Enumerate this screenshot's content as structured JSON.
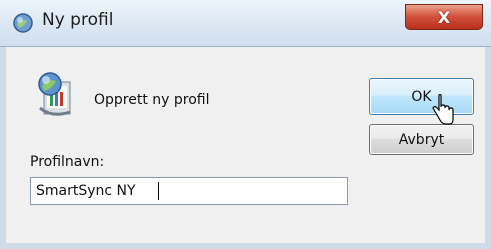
{
  "window": {
    "title": "Ny profil",
    "title_icon": "mail-profile-icon",
    "close_glyph": "X"
  },
  "dialog": {
    "create_label": "Opprett ny profil",
    "field_label": "Profilnavn:",
    "name_value": "SmartSync NY",
    "ok_label": "OK",
    "cancel_label": "Avbryt"
  },
  "colors": {
    "ok_border": "#3c7fb1",
    "close_red": "#d2503a",
    "frame": "#cfdbe8"
  }
}
